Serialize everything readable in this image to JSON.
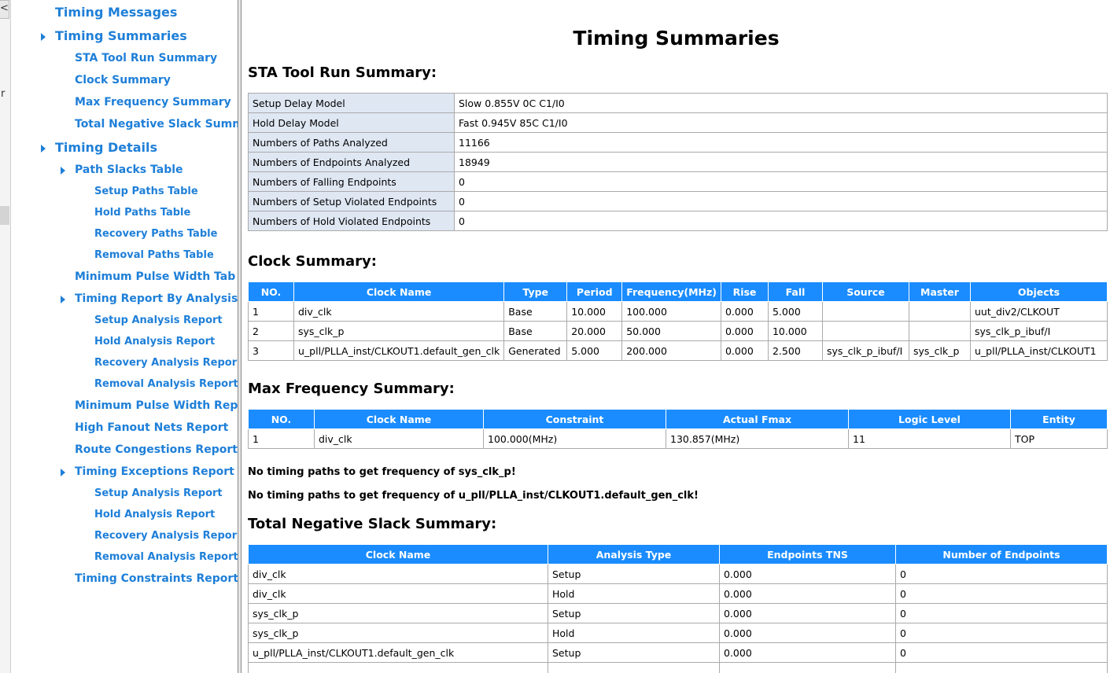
{
  "edge": {
    "button": "<",
    "char": "r"
  },
  "nav": {
    "items": [
      {
        "label": "Timing Messages"
      },
      {
        "label": "Timing Summaries"
      },
      {
        "label": "STA Tool Run Summary"
      },
      {
        "label": "Clock Summary"
      },
      {
        "label": "Max Frequency Summary"
      },
      {
        "label": "Total Negative Slack Summ"
      },
      {
        "label": "Timing Details"
      },
      {
        "label": "Path Slacks Table"
      },
      {
        "label": "Setup Paths Table"
      },
      {
        "label": "Hold Paths Table"
      },
      {
        "label": "Recovery Paths Table"
      },
      {
        "label": "Removal Paths Table"
      },
      {
        "label": "Minimum Pulse Width Tab"
      },
      {
        "label": "Timing Report By Analysis"
      },
      {
        "label": "Setup Analysis Report"
      },
      {
        "label": "Hold Analysis Report"
      },
      {
        "label": "Recovery Analysis Repor"
      },
      {
        "label": "Removal Analysis Report"
      },
      {
        "label": "Minimum Pulse Width Rep"
      },
      {
        "label": "High Fanout Nets Report"
      },
      {
        "label": "Route Congestions Report"
      },
      {
        "label": "Timing Exceptions Report"
      },
      {
        "label": "Setup Analysis Report"
      },
      {
        "label": "Hold Analysis Report"
      },
      {
        "label": "Recovery Analysis Repor"
      },
      {
        "label": "Removal Analysis Report"
      },
      {
        "label": "Timing Constraints Report"
      }
    ]
  },
  "main": {
    "title": "Timing Summaries",
    "sta": {
      "title": "STA Tool Run Summary:",
      "rows": [
        [
          "Setup Delay Model",
          "Slow 0.855V 0C C1/I0"
        ],
        [
          "Hold Delay Model",
          "Fast 0.945V 85C C1/I0"
        ],
        [
          "Numbers of Paths Analyzed",
          "11166"
        ],
        [
          "Numbers of Endpoints Analyzed",
          "18949"
        ],
        [
          "Numbers of Falling Endpoints",
          "0"
        ],
        [
          "Numbers of Setup Violated Endpoints",
          "0"
        ],
        [
          "Numbers of Hold Violated Endpoints",
          "0"
        ]
      ]
    },
    "clock": {
      "title": "Clock Summary:",
      "headers": [
        "NO.",
        "Clock Name",
        "Type",
        "Period",
        "Frequency(MHz)",
        "Rise",
        "Fall",
        "Source",
        "Master",
        "Objects"
      ],
      "rows": [
        [
          "1",
          "div_clk",
          "Base",
          "10.000",
          "100.000",
          "0.000",
          "5.000",
          "",
          "",
          "uut_div2/CLKOUT"
        ],
        [
          "2",
          "sys_clk_p",
          "Base",
          "20.000",
          "50.000",
          "0.000",
          "10.000",
          "",
          "",
          "sys_clk_p_ibuf/I"
        ],
        [
          "3",
          "u_pll/PLLA_inst/CLKOUT1.default_gen_clk",
          "Generated",
          "5.000",
          "200.000",
          "0.000",
          "2.500",
          "sys_clk_p_ibuf/I",
          "sys_clk_p",
          "u_pll/PLLA_inst/CLKOUT1"
        ]
      ]
    },
    "fmax": {
      "title": "Max Frequency Summary:",
      "headers": [
        "NO.",
        "Clock Name",
        "Constraint",
        "Actual Fmax",
        "Logic Level",
        "Entity"
      ],
      "rows": [
        [
          "1",
          "div_clk",
          "100.000(MHz)",
          "130.857(MHz)",
          "11",
          "TOP"
        ]
      ],
      "notes": [
        "No timing paths to get frequency of sys_clk_p!",
        "No timing paths to get frequency of u_pll/PLLA_inst/CLKOUT1.default_gen_clk!"
      ]
    },
    "tns": {
      "title": "Total Negative Slack Summary:",
      "headers": [
        "Clock Name",
        "Analysis Type",
        "Endpoints TNS",
        "Number of Endpoints"
      ],
      "rows": [
        [
          "div_clk",
          "Setup",
          "0.000",
          "0"
        ],
        [
          "div_clk",
          "Hold",
          "0.000",
          "0"
        ],
        [
          "sys_clk_p",
          "Setup",
          "0.000",
          "0"
        ],
        [
          "sys_clk_p",
          "Hold",
          "0.000",
          "0"
        ],
        [
          "u_pll/PLLA_inst/CLKOUT1.default_gen_clk",
          "Setup",
          "0.000",
          "0"
        ],
        [
          "",
          "",
          "",
          ""
        ]
      ]
    }
  }
}
